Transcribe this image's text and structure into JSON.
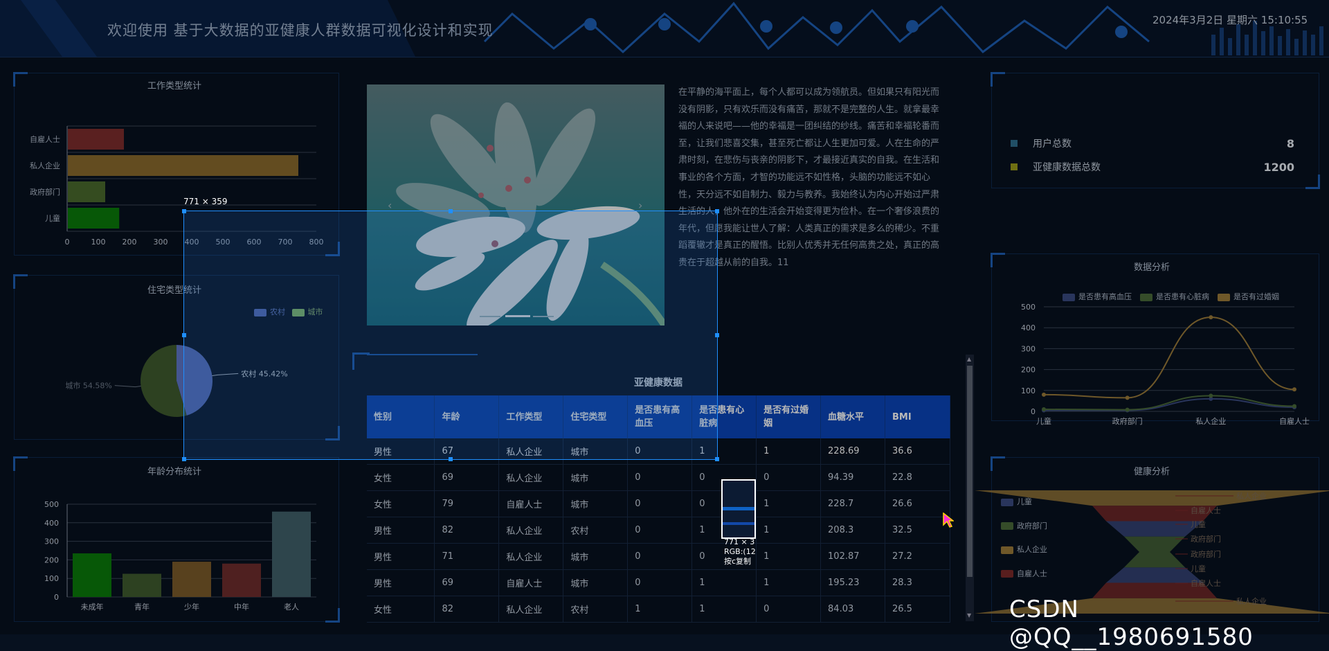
{
  "header": {
    "title": "欢迎使用 基于大数据的亚健康人群数据可视化设计和实现",
    "datetime": "2024年3月2日 星期六 15:10:55"
  },
  "work_chart": {
    "title": "工作类型统计",
    "chart_data": {
      "type": "bar",
      "orientation": "horizontal",
      "categories": [
        "自雇人士",
        "私人企业",
        "政府部门",
        "儿童"
      ],
      "values": [
        180,
        740,
        120,
        165
      ],
      "xlim": [
        0,
        800
      ],
      "xticks": [
        "0",
        "100",
        "200",
        "300",
        "400",
        "500",
        "600",
        "700",
        "800"
      ],
      "colors": [
        "#7d2d2d",
        "#8a6a2d",
        "#4a6a2d",
        "#0a7a0a"
      ]
    }
  },
  "house_chart": {
    "title": "住宅类型统计",
    "chart_data": {
      "type": "pie",
      "labels": [
        "农村",
        "城市"
      ],
      "values": [
        45.42,
        54.58
      ],
      "value_labels": [
        "农村 45.42%",
        "城市 54.58%"
      ],
      "colors": [
        "#5f76c8",
        "#3f5a2e"
      ],
      "legend": [
        "农村",
        "城市"
      ],
      "legend_colors": [
        "#5f76c8",
        "#94cc6a"
      ]
    }
  },
  "age_chart": {
    "title": "年龄分布统计",
    "chart_data": {
      "type": "bar",
      "categories": [
        "未成年",
        "青年",
        "少年",
        "中年",
        "老人"
      ],
      "values": [
        235,
        125,
        190,
        180,
        460
      ],
      "ylim": [
        0,
        500
      ],
      "yticks": [
        "0",
        "100",
        "200",
        "300",
        "400",
        "500"
      ],
      "colors": [
        "#0a7a0a",
        "#3f5a2e",
        "#7a5a2a",
        "#6e2d2d",
        "#41606a"
      ]
    }
  },
  "carousel": {
    "prev": "‹",
    "next": "›"
  },
  "article": {
    "lines": [
      "在平静的海平面上，每个人都可以成为领航员。但如果只有阳光而",
      "没有阴影，只有欢乐而没有痛苦，那就不是完整的人生。就拿最幸",
      "福的人来说吧——他的幸福是一团纠结的纱线。痛苦和幸福轮番而",
      "至，让我们悲喜交集，甚至死亡都让人生更加可爱。人在生命的严",
      "肃时刻，在悲伤与丧亲的阴影下，才最接近真实的自我。在生活和",
      "事业的各个方面，才智的功能远不如性格，头脑的功能远不如心",
      "性，天分远不如自制力、毅力与教养。我始终认为内心开始过严肃",
      "生活的人，他外在的生活会开始变得更为俭朴。在一个奢侈浪费的",
      "年代，但愿我能让世人了解：人类真正的需求是多么的稀少。不重",
      "蹈覆辙才是真正的醒悟。比别人优秀并无任何高贵之处，真正的高",
      "贵在于超越从前的自我。11"
    ]
  },
  "table": {
    "title": "亚健康数据",
    "headers": [
      "性别",
      "年龄",
      "工作类型",
      "住宅类型",
      "是否患有高血压",
      "是否患有心脏病",
      "是否有过婚姻",
      "血糖水平",
      "BMI"
    ],
    "rows": [
      [
        "男性",
        "67",
        "私人企业",
        "城市",
        "0",
        "1",
        "1",
        "228.69",
        "36.6"
      ],
      [
        "女性",
        "69",
        "私人企业",
        "城市",
        "0",
        "0",
        "0",
        "94.39",
        "22.8"
      ],
      [
        "女性",
        "79",
        "自雇人士",
        "城市",
        "0",
        "0",
        "1",
        "228.7",
        "26.6"
      ],
      [
        "男性",
        "82",
        "私人企业",
        "农村",
        "0",
        "1",
        "1",
        "208.3",
        "32.5"
      ],
      [
        "男性",
        "71",
        "私人企业",
        "城市",
        "0",
        "0",
        "1",
        "102.87",
        "27.2"
      ],
      [
        "男性",
        "69",
        "自雇人士",
        "城市",
        "0",
        "1",
        "1",
        "195.23",
        "28.3"
      ],
      [
        "女性",
        "82",
        "私人企业",
        "农村",
        "1",
        "1",
        "0",
        "84.03",
        "26.5"
      ]
    ]
  },
  "stats": {
    "items": [
      {
        "label": "用户总数",
        "value": "8",
        "color": "#2f6e8e"
      },
      {
        "label": "亚健康数据总数",
        "value": "1200",
        "color": "#9a9a1a"
      }
    ]
  },
  "analysis_chart": {
    "title": "数据分析",
    "chart_data": {
      "type": "line",
      "categories": [
        "儿童",
        "政府部门",
        "私人企业",
        "自雇人士"
      ],
      "series": [
        {
          "name": "是否患有高血压",
          "values": [
            5,
            5,
            60,
            20
          ],
          "color": "#3a4a80"
        },
        {
          "name": "是否患有心脏病",
          "values": [
            10,
            8,
            75,
            25
          ],
          "color": "#4a6a3a"
        },
        {
          "name": "是否有过婚姻",
          "values": [
            80,
            65,
            450,
            105
          ],
          "color": "#9a7a3a"
        }
      ],
      "ylim": [
        0,
        500
      ],
      "yticks": [
        "0",
        "100",
        "200",
        "300",
        "400",
        "500"
      ]
    }
  },
  "health_chart": {
    "title": "健康分析",
    "chart_data": {
      "type": "funnel",
      "legend": [
        "儿童",
        "政府部门",
        "私人企业",
        "自雇人士"
      ],
      "legend_colors": [
        "#3a4a80",
        "#4a6a3a",
        "#9a7a3a",
        "#7a2a2a"
      ],
      "labels": [
        "私人企业",
        "自雇人士",
        "儿童",
        "政府部门",
        "政府部门",
        "儿童",
        "自雇人士",
        "私人企业"
      ]
    }
  },
  "overlay": {
    "selection_size": "771 × 359",
    "mag_size": "771 × 3",
    "mag_rgb": "RGB:(12",
    "mag_copy": "按c复制"
  },
  "watermark": "CSDN @QQ__1980691580"
}
